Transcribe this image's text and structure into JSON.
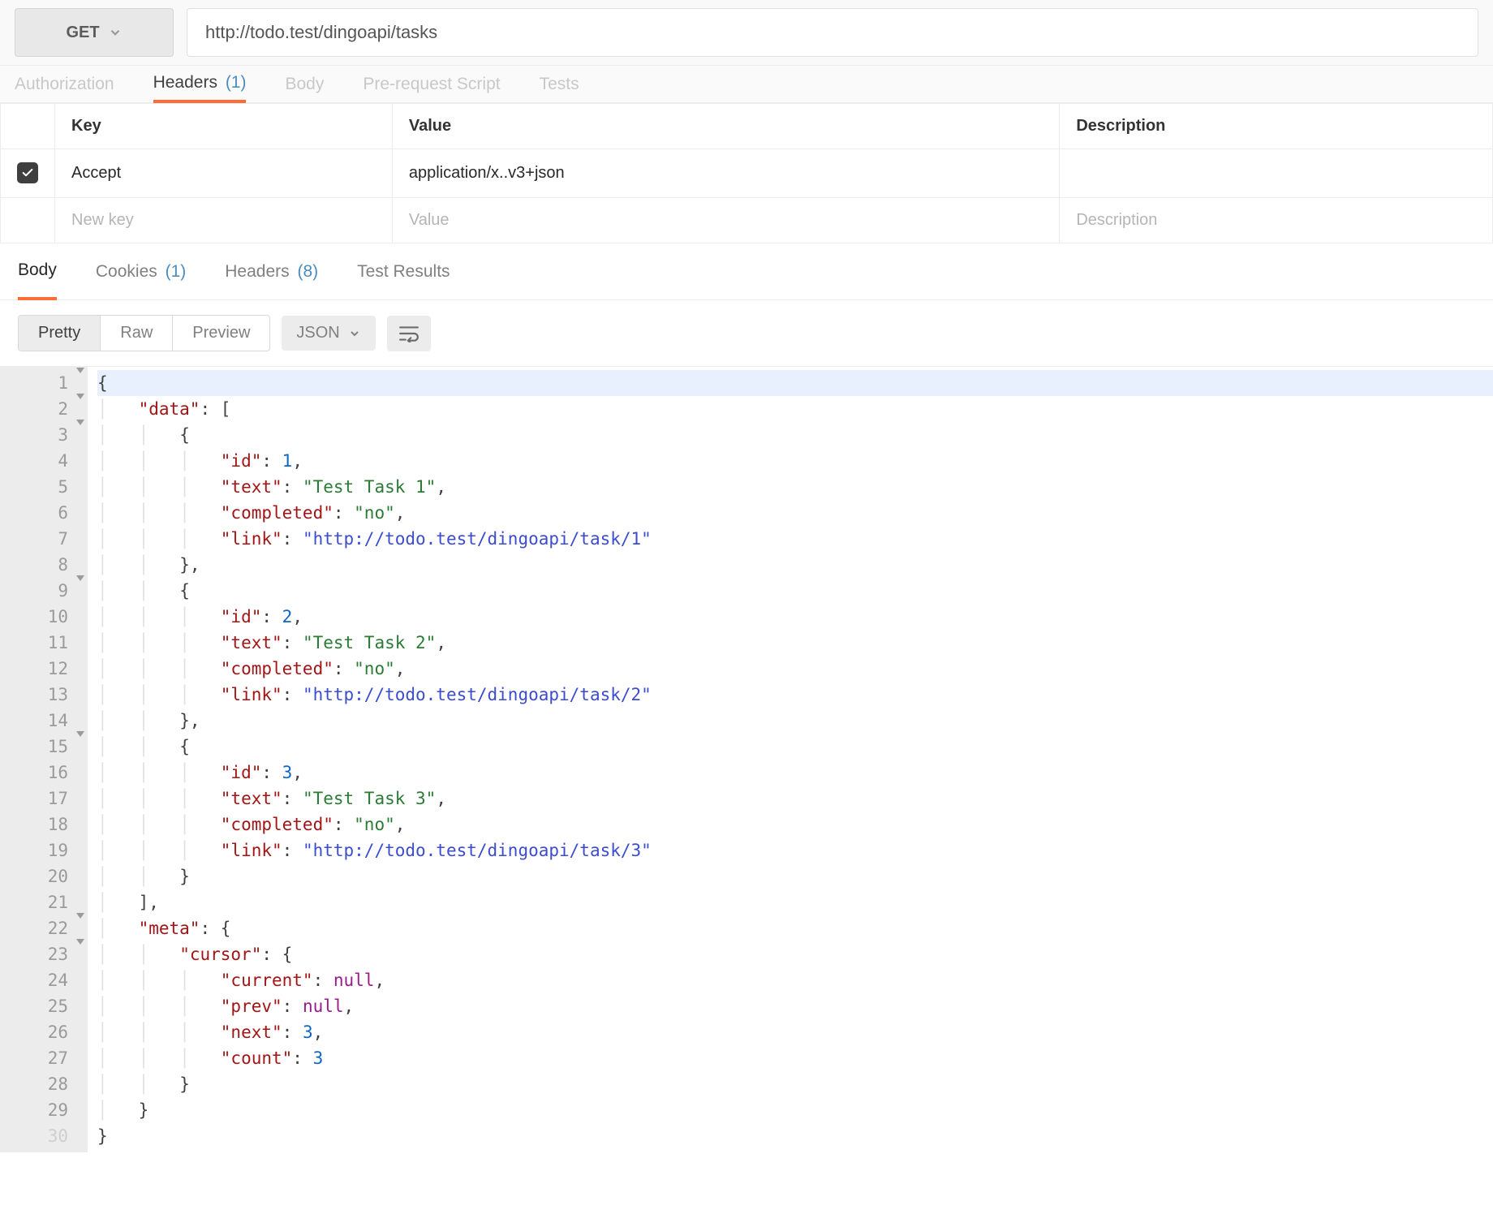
{
  "request": {
    "method": "GET",
    "url": "http://todo.test/dingoapi/tasks"
  },
  "request_tabs": {
    "authorization": "Authorization",
    "headers": "Headers",
    "headers_count": "(1)",
    "body": "Body",
    "prerequest": "Pre-request Script",
    "tests": "Tests"
  },
  "headers_table": {
    "cols": {
      "key": "Key",
      "value": "Value",
      "description": "Description"
    },
    "rows": [
      {
        "enabled": true,
        "key": "Accept",
        "value": "application/x..v3+json",
        "description": ""
      }
    ],
    "placeholders": {
      "key": "New key",
      "value": "Value",
      "description": "Description"
    }
  },
  "response_tabs": {
    "body": "Body",
    "cookies": "Cookies",
    "cookies_count": "(1)",
    "headers": "Headers",
    "headers_count": "(8)",
    "test_results": "Test Results"
  },
  "response_toolbar": {
    "pretty": "Pretty",
    "raw": "Raw",
    "preview": "Preview",
    "format": "JSON"
  },
  "code_lines": [
    {
      "n": 1,
      "fold": true,
      "indent": 0,
      "tokens": [
        {
          "t": "punct",
          "v": "{"
        }
      ],
      "hl": true
    },
    {
      "n": 2,
      "fold": true,
      "indent": 1,
      "tokens": [
        {
          "t": "key",
          "v": "\"data\""
        },
        {
          "t": "punct",
          "v": ": ["
        }
      ]
    },
    {
      "n": 3,
      "fold": true,
      "indent": 2,
      "tokens": [
        {
          "t": "punct",
          "v": "{"
        }
      ]
    },
    {
      "n": 4,
      "fold": false,
      "indent": 3,
      "tokens": [
        {
          "t": "key",
          "v": "\"id\""
        },
        {
          "t": "punct",
          "v": ": "
        },
        {
          "t": "num",
          "v": "1"
        },
        {
          "t": "punct",
          "v": ","
        }
      ]
    },
    {
      "n": 5,
      "fold": false,
      "indent": 3,
      "tokens": [
        {
          "t": "key",
          "v": "\"text\""
        },
        {
          "t": "punct",
          "v": ": "
        },
        {
          "t": "str",
          "v": "\"Test Task 1\""
        },
        {
          "t": "punct",
          "v": ","
        }
      ]
    },
    {
      "n": 6,
      "fold": false,
      "indent": 3,
      "tokens": [
        {
          "t": "key",
          "v": "\"completed\""
        },
        {
          "t": "punct",
          "v": ": "
        },
        {
          "t": "str",
          "v": "\"no\""
        },
        {
          "t": "punct",
          "v": ","
        }
      ]
    },
    {
      "n": 7,
      "fold": false,
      "indent": 3,
      "tokens": [
        {
          "t": "key",
          "v": "\"link\""
        },
        {
          "t": "punct",
          "v": ": "
        },
        {
          "t": "url",
          "v": "\"http://todo.test/dingoapi/task/1\""
        }
      ]
    },
    {
      "n": 8,
      "fold": false,
      "indent": 2,
      "tokens": [
        {
          "t": "punct",
          "v": "},"
        }
      ]
    },
    {
      "n": 9,
      "fold": true,
      "indent": 2,
      "tokens": [
        {
          "t": "punct",
          "v": "{"
        }
      ]
    },
    {
      "n": 10,
      "fold": false,
      "indent": 3,
      "tokens": [
        {
          "t": "key",
          "v": "\"id\""
        },
        {
          "t": "punct",
          "v": ": "
        },
        {
          "t": "num",
          "v": "2"
        },
        {
          "t": "punct",
          "v": ","
        }
      ]
    },
    {
      "n": 11,
      "fold": false,
      "indent": 3,
      "tokens": [
        {
          "t": "key",
          "v": "\"text\""
        },
        {
          "t": "punct",
          "v": ": "
        },
        {
          "t": "str",
          "v": "\"Test Task 2\""
        },
        {
          "t": "punct",
          "v": ","
        }
      ]
    },
    {
      "n": 12,
      "fold": false,
      "indent": 3,
      "tokens": [
        {
          "t": "key",
          "v": "\"completed\""
        },
        {
          "t": "punct",
          "v": ": "
        },
        {
          "t": "str",
          "v": "\"no\""
        },
        {
          "t": "punct",
          "v": ","
        }
      ]
    },
    {
      "n": 13,
      "fold": false,
      "indent": 3,
      "tokens": [
        {
          "t": "key",
          "v": "\"link\""
        },
        {
          "t": "punct",
          "v": ": "
        },
        {
          "t": "url",
          "v": "\"http://todo.test/dingoapi/task/2\""
        }
      ]
    },
    {
      "n": 14,
      "fold": false,
      "indent": 2,
      "tokens": [
        {
          "t": "punct",
          "v": "},"
        }
      ]
    },
    {
      "n": 15,
      "fold": true,
      "indent": 2,
      "tokens": [
        {
          "t": "punct",
          "v": "{"
        }
      ]
    },
    {
      "n": 16,
      "fold": false,
      "indent": 3,
      "tokens": [
        {
          "t": "key",
          "v": "\"id\""
        },
        {
          "t": "punct",
          "v": ": "
        },
        {
          "t": "num",
          "v": "3"
        },
        {
          "t": "punct",
          "v": ","
        }
      ]
    },
    {
      "n": 17,
      "fold": false,
      "indent": 3,
      "tokens": [
        {
          "t": "key",
          "v": "\"text\""
        },
        {
          "t": "punct",
          "v": ": "
        },
        {
          "t": "str",
          "v": "\"Test Task 3\""
        },
        {
          "t": "punct",
          "v": ","
        }
      ]
    },
    {
      "n": 18,
      "fold": false,
      "indent": 3,
      "tokens": [
        {
          "t": "key",
          "v": "\"completed\""
        },
        {
          "t": "punct",
          "v": ": "
        },
        {
          "t": "str",
          "v": "\"no\""
        },
        {
          "t": "punct",
          "v": ","
        }
      ]
    },
    {
      "n": 19,
      "fold": false,
      "indent": 3,
      "tokens": [
        {
          "t": "key",
          "v": "\"link\""
        },
        {
          "t": "punct",
          "v": ": "
        },
        {
          "t": "url",
          "v": "\"http://todo.test/dingoapi/task/3\""
        }
      ]
    },
    {
      "n": 20,
      "fold": false,
      "indent": 2,
      "tokens": [
        {
          "t": "punct",
          "v": "}"
        }
      ]
    },
    {
      "n": 21,
      "fold": false,
      "indent": 1,
      "tokens": [
        {
          "t": "punct",
          "v": "],"
        }
      ]
    },
    {
      "n": 22,
      "fold": true,
      "indent": 1,
      "tokens": [
        {
          "t": "key",
          "v": "\"meta\""
        },
        {
          "t": "punct",
          "v": ": {"
        }
      ]
    },
    {
      "n": 23,
      "fold": true,
      "indent": 2,
      "tokens": [
        {
          "t": "key",
          "v": "\"cursor\""
        },
        {
          "t": "punct",
          "v": ": {"
        }
      ]
    },
    {
      "n": 24,
      "fold": false,
      "indent": 3,
      "tokens": [
        {
          "t": "key",
          "v": "\"current\""
        },
        {
          "t": "punct",
          "v": ": "
        },
        {
          "t": "null",
          "v": "null"
        },
        {
          "t": "punct",
          "v": ","
        }
      ]
    },
    {
      "n": 25,
      "fold": false,
      "indent": 3,
      "tokens": [
        {
          "t": "key",
          "v": "\"prev\""
        },
        {
          "t": "punct",
          "v": ": "
        },
        {
          "t": "null",
          "v": "null"
        },
        {
          "t": "punct",
          "v": ","
        }
      ]
    },
    {
      "n": 26,
      "fold": false,
      "indent": 3,
      "tokens": [
        {
          "t": "key",
          "v": "\"next\""
        },
        {
          "t": "punct",
          "v": ": "
        },
        {
          "t": "num",
          "v": "3"
        },
        {
          "t": "punct",
          "v": ","
        }
      ]
    },
    {
      "n": 27,
      "fold": false,
      "indent": 3,
      "tokens": [
        {
          "t": "key",
          "v": "\"count\""
        },
        {
          "t": "punct",
          "v": ": "
        },
        {
          "t": "num",
          "v": "3"
        }
      ]
    },
    {
      "n": 28,
      "fold": false,
      "indent": 2,
      "tokens": [
        {
          "t": "punct",
          "v": "}"
        }
      ]
    },
    {
      "n": 29,
      "fold": false,
      "indent": 1,
      "tokens": [
        {
          "t": "punct",
          "v": "}"
        }
      ]
    },
    {
      "n": 30,
      "fold": false,
      "indent": 0,
      "tokens": [
        {
          "t": "punct",
          "v": "}"
        }
      ],
      "dim": true
    }
  ]
}
